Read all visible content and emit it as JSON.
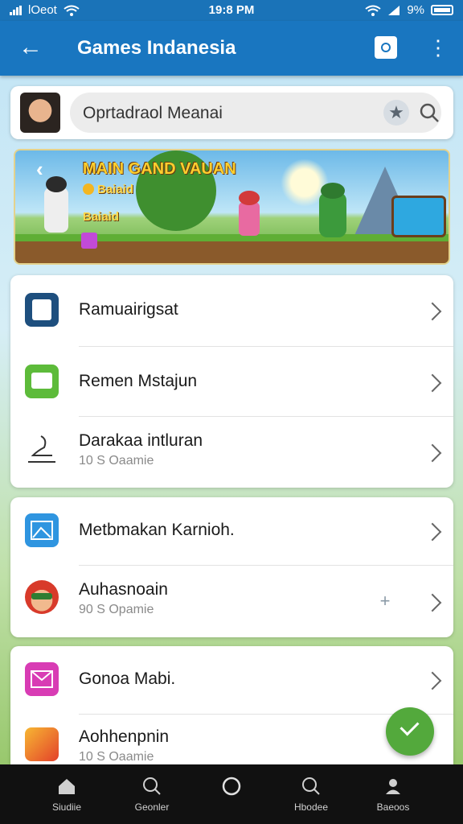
{
  "status_bar": {
    "carrier": "lOeot",
    "time": "19:8 PM",
    "battery": "9%"
  },
  "app_bar": {
    "title": "Games Indanesia"
  },
  "search": {
    "value": "Oprtadraol Meanai"
  },
  "banner": {
    "heading": "MAIN GAND VAUAN",
    "coin_text": "Baiaid",
    "score_text": "Baiaid"
  },
  "list_groups": [
    {
      "items": [
        {
          "label": "Ramuairigsat",
          "subtitle": ""
        },
        {
          "label": "Remen Mstajun",
          "subtitle": ""
        },
        {
          "label": "Darakaa intluran",
          "subtitle": "10 S Oaamie"
        }
      ]
    },
    {
      "items": [
        {
          "label": "Metbmakan Karnioh.",
          "subtitle": ""
        },
        {
          "label": "Auhasnoain",
          "subtitle": "90 S Opamie"
        }
      ]
    },
    {
      "items": [
        {
          "label": "Gonoa Mabi.",
          "subtitle": ""
        },
        {
          "label": "Aohhenpnin",
          "subtitle": "10 S Oaamie"
        }
      ]
    }
  ],
  "bottom_nav": [
    {
      "label": "Siudiie",
      "icon": "home-icon"
    },
    {
      "label": "Geonler",
      "icon": "search-icon"
    },
    {
      "label": "",
      "icon": "circle-icon"
    },
    {
      "label": "Hbodee",
      "icon": "search-icon"
    },
    {
      "label": "Baeoos",
      "icon": "profile-icon"
    }
  ],
  "colors": {
    "primary": "#1976c0",
    "fab": "#53a93c",
    "nav_bg": "#111111"
  }
}
